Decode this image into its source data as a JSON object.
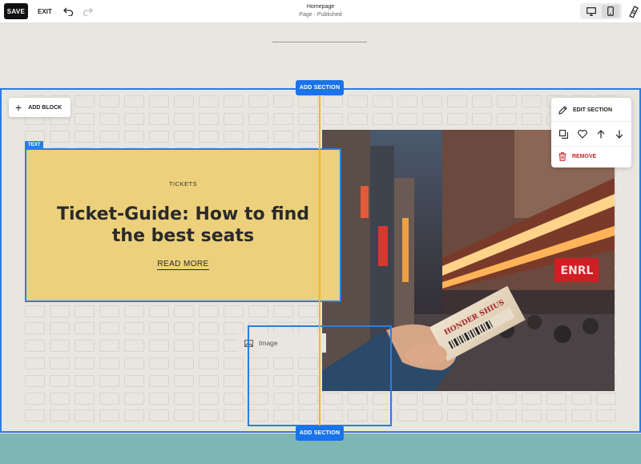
{
  "toolbar": {
    "save_label": "SAVE",
    "exit_label": "EXIT",
    "page_title": "Homepage",
    "page_status": "Page · Published"
  },
  "section_controls": {
    "add_block_label": "ADD BLOCK",
    "add_section_top_label": "ADD SECTION",
    "add_section_bottom_label": "ADD SECTION"
  },
  "text_block": {
    "tag": "TEXT",
    "eyebrow": "TICKETS",
    "headline": "Ticket-Guide: How to find the best seats",
    "link_label": "READ MORE"
  },
  "image_block": {
    "placeholder_label": "Image"
  },
  "edit_menu": {
    "edit_label": "EDIT SECTION",
    "remove_label": "REMOVE"
  },
  "colors": {
    "accent": "#2b7de0",
    "add_section": "#1a73e8",
    "guide": "#f0b91b",
    "text_block_bg": "#ecd07c",
    "remove": "#c6282c",
    "footer_section": "#7db6b3"
  },
  "icons": [
    "undo-icon",
    "redo-icon",
    "desktop-icon",
    "mobile-icon",
    "design-icon",
    "plus-icon",
    "picture-icon",
    "pencil-icon",
    "duplicate-icon",
    "heart-icon",
    "arrow-up-icon",
    "arrow-down-icon",
    "trash-icon"
  ]
}
